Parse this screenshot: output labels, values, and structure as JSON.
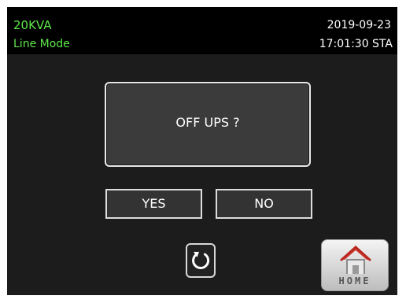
{
  "status": {
    "model": "20KVA",
    "mode": "Line Mode",
    "date": "2019-09-23",
    "time": "17:01:30 STA"
  },
  "dialog": {
    "message": "OFF UPS ?",
    "yes_label": "YES",
    "no_label": "NO"
  },
  "nav": {
    "back_icon": "rotate-back-icon",
    "home_icon": "house-icon",
    "home_label": "HOME"
  },
  "colors": {
    "screen_bg": "#1c1c1c",
    "status_bg": "#000000",
    "mode_text": "#5ee84a",
    "roof_red": "#d23a32"
  }
}
